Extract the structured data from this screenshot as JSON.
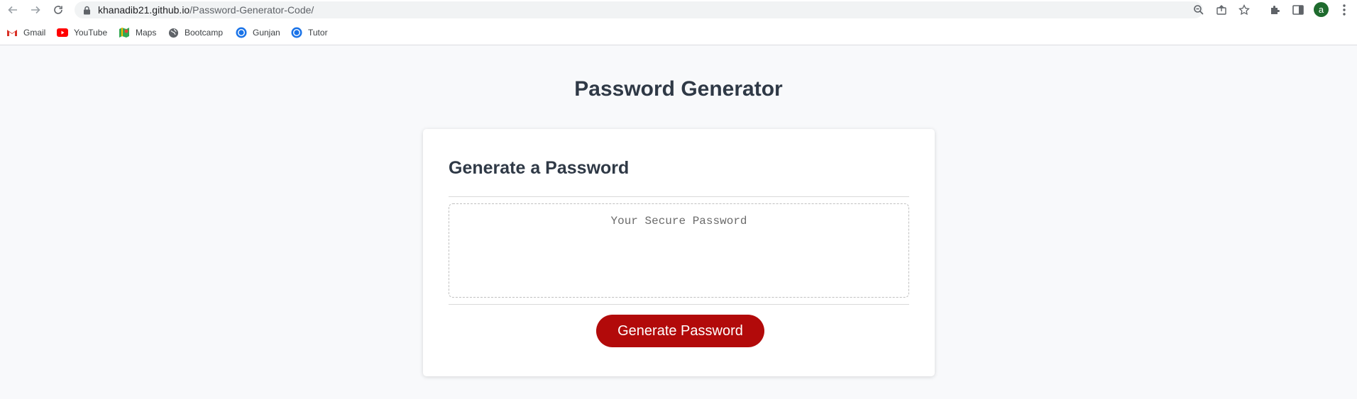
{
  "browser": {
    "url_host": "khanadib21.github.io",
    "url_path": "/Password-Generator-Code/",
    "avatar_letter": "a"
  },
  "bookmarks": [
    {
      "label": "Gmail",
      "icon": "gmail-icon"
    },
    {
      "label": "YouTube",
      "icon": "youtube-icon"
    },
    {
      "label": "Maps",
      "icon": "maps-icon"
    },
    {
      "label": "Bootcamp",
      "icon": "globe-icon"
    },
    {
      "label": "Gunjan",
      "icon": "chromium-icon"
    },
    {
      "label": "Tutor",
      "icon": "chromium-icon"
    }
  ],
  "page": {
    "title": "Password Generator",
    "card_header": "Generate a Password",
    "password_placeholder": "Your Secure Password",
    "generate_button": "Generate Password"
  },
  "colors": {
    "button": "#b20a0a",
    "title_text": "#2f3946",
    "page_bg": "#f8f9fb"
  }
}
